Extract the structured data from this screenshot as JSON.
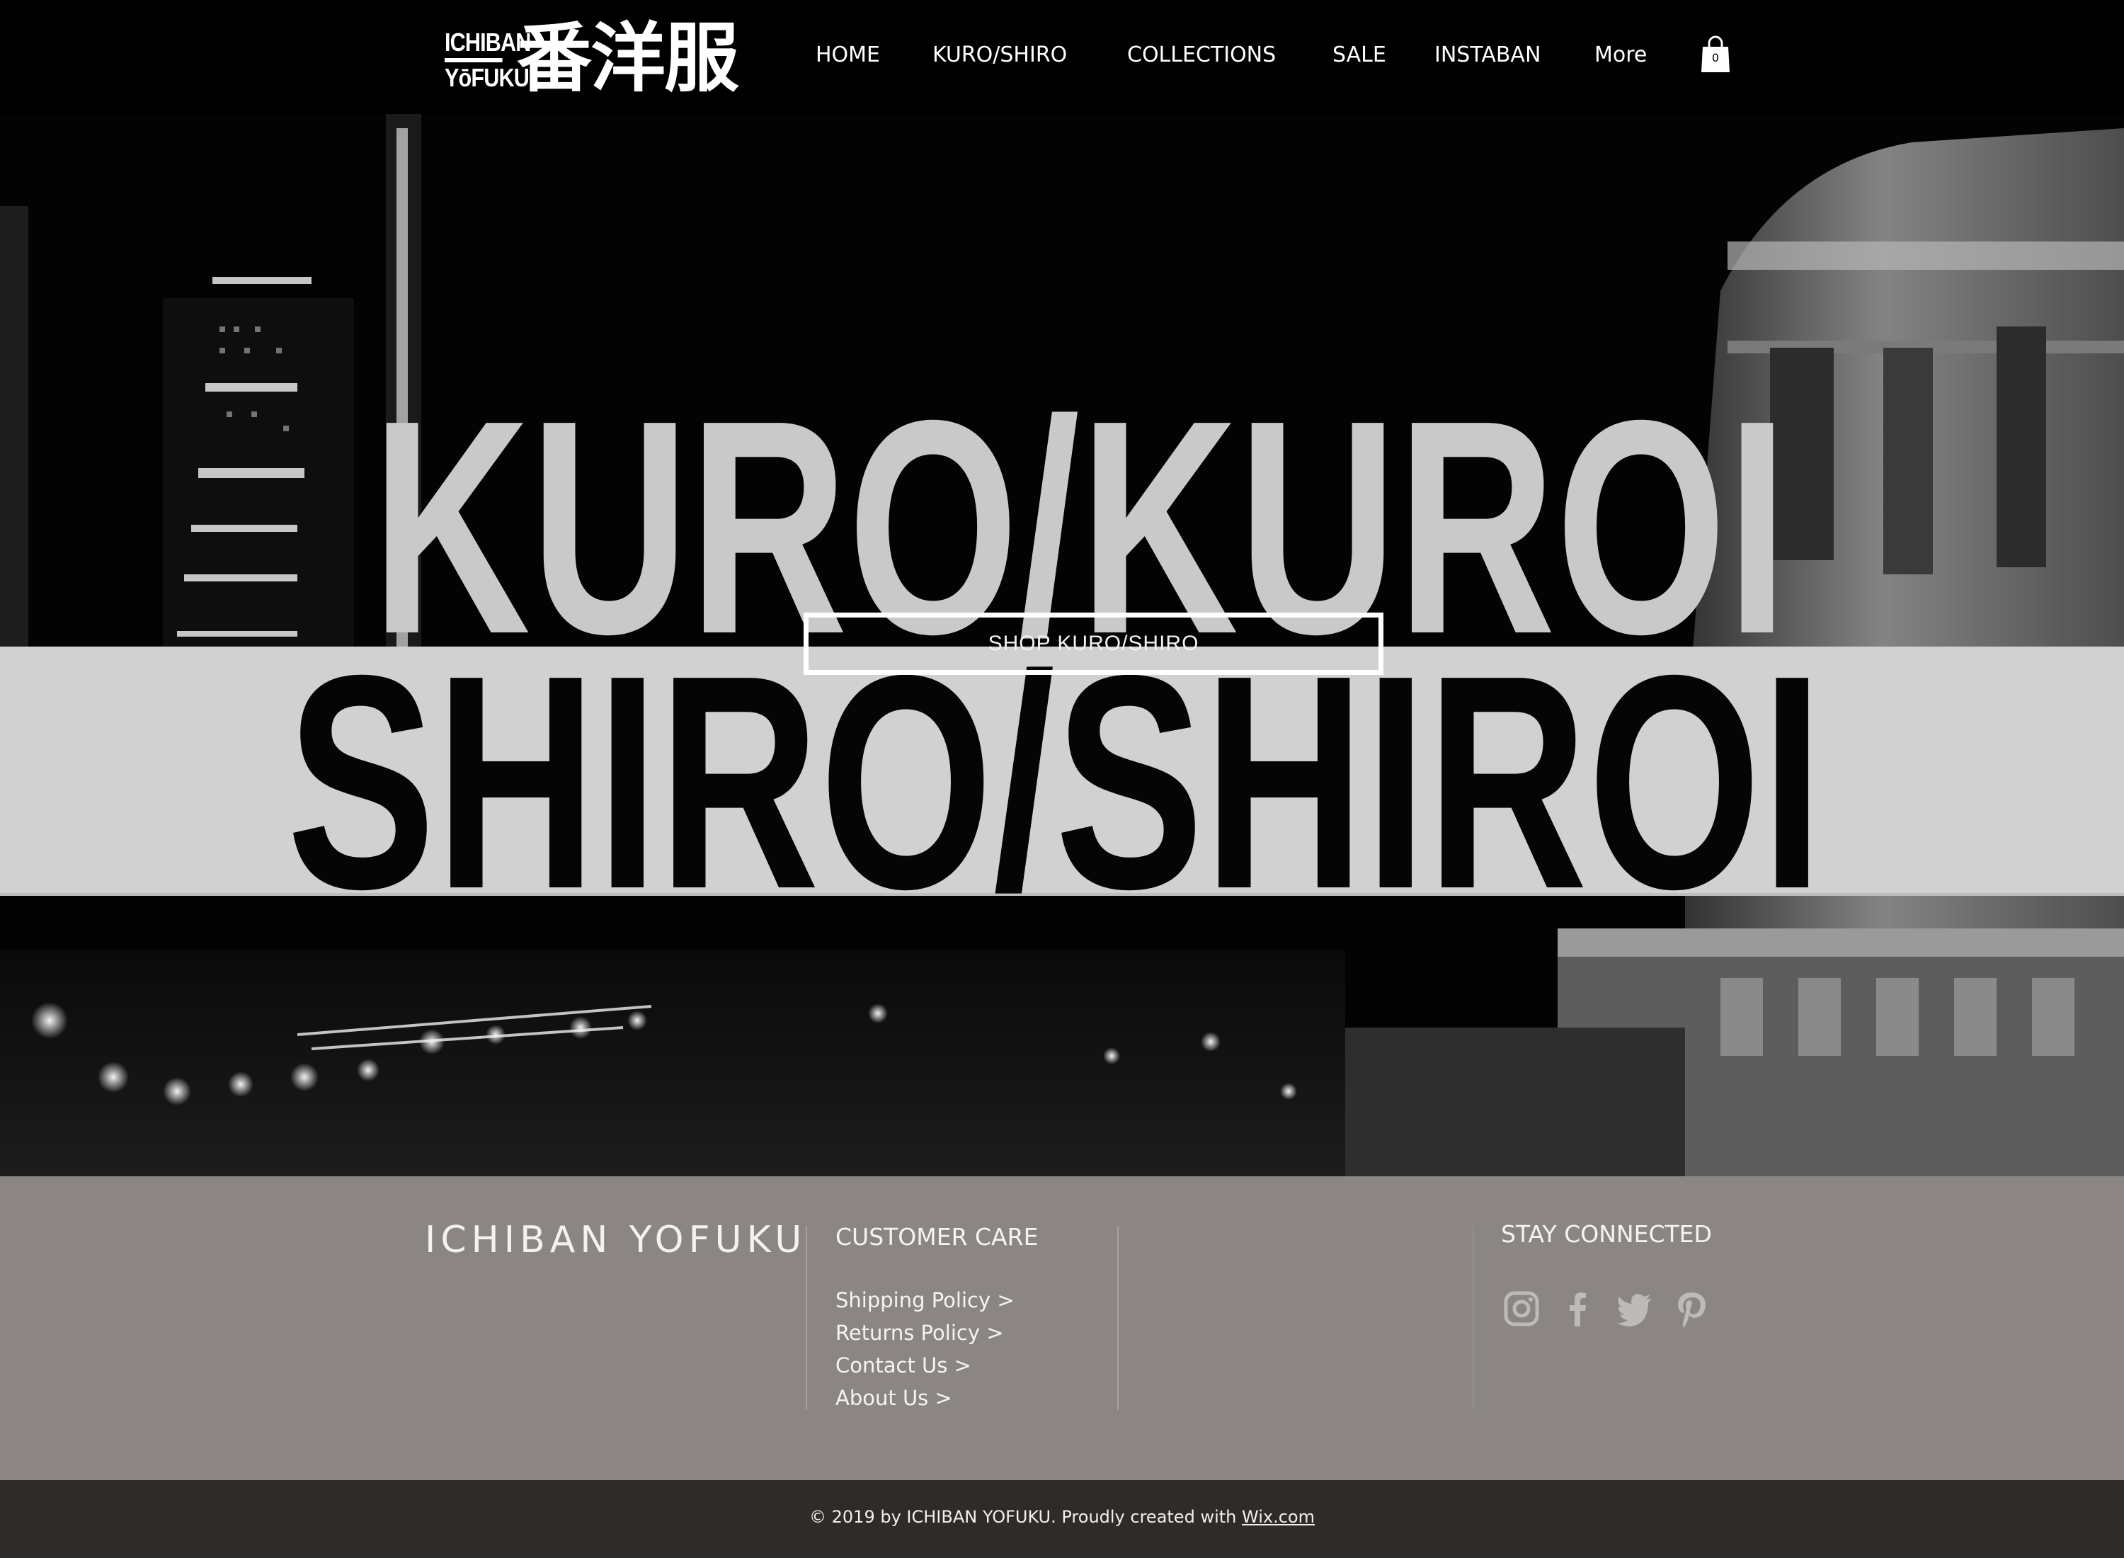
{
  "header": {
    "logo": {
      "latin_line1": "ICHIBAN",
      "latin_line2": "YōFUKU",
      "kanji": "番洋服"
    },
    "nav": [
      {
        "label": "HOME"
      },
      {
        "label": "KURO/SHIRO"
      },
      {
        "label": "COLLECTIONS"
      },
      {
        "label": "SALE"
      },
      {
        "label": "INSTABAN"
      },
      {
        "label": "More"
      }
    ],
    "cart_count": "0"
  },
  "hero": {
    "line1": "KURO/KUROI",
    "line2": "SHIRO/SHIROI",
    "button_label": "SHOP KURO/SHIRO"
  },
  "footer": {
    "brand": "ICHIBAN YOFUKU",
    "customer_care": {
      "title": "CUSTOMER CARE",
      "links": [
        "Shipping Policy >",
        "Returns Policy >",
        "Contact Us >",
        "About Us >"
      ]
    },
    "stay_connected": {
      "title": "STAY CONNECTED",
      "icons": [
        "instagram-icon",
        "facebook-icon",
        "twitter-icon",
        "pinterest-icon"
      ]
    },
    "copyright": "© 2019 by ICHIBAN YOFUKU. Proudly created with",
    "copyright_link": "Wix.com"
  },
  "colors": {
    "header_bg": "#000000",
    "footer_bg": "#8b8683",
    "bottom_bar_bg": "#2f2b29",
    "title_light": "#c9c9c9",
    "band_light": "#d1d1d1"
  }
}
